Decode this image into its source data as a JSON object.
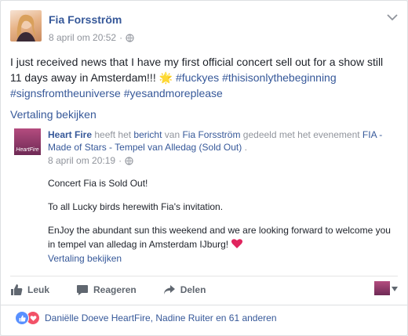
{
  "post": {
    "author": "Fia Forsström",
    "timestamp": "8 april om 20:52",
    "text_plain": "I just received news that I have my first official concert sell out for a show still 11 days away in Amsterdam!!! ",
    "emoji": "🌟",
    "hashtags": [
      "#fuckyes",
      "#thisisonlythebeginning",
      "#signsfromtheuniverse",
      "#yesandmoreplease"
    ],
    "translate_label": "Vertaling bekijken"
  },
  "shared": {
    "avatar_text": "HeartFire",
    "page_name": "Heart Fire",
    "text_1": " heeft het ",
    "link_1": "bericht",
    "text_2": " van ",
    "link_2": "Fia Forsström",
    "text_3": " gedeeld met het evenement ",
    "event_name": "FIA - Made of Stars - Tempel van Alledag (Sold Out)",
    "text_4": " .",
    "timestamp": "8 april om 20:19",
    "paragraph_1": "Concert Fia is Sold Out!",
    "paragraph_2": "To all Lucky birds herewith Fia's invitation.",
    "paragraph_3": "EnJoy the abundant sun this weekend and we are looking forward to welcome you in tempel van alledag in Amsterdam IJburg! ",
    "translate_label": "Vertaling bekijken"
  },
  "actions": {
    "like": "Leuk",
    "comment": "Reageren",
    "share": "Delen"
  },
  "reactions": {
    "summary": "Daniëlle Doeve HeartFire, Nadine Ruiter en 61 anderen"
  },
  "icons": {
    "globe": "globe-icon",
    "chevron": "chevron-down-icon",
    "like": "thumbs-up-icon",
    "comment": "comment-icon",
    "share": "share-arrow-icon",
    "heart": "heart-icon"
  },
  "colors": {
    "link": "#365899",
    "meta": "#90949c",
    "like_reaction": "#5890ff",
    "love_reaction": "#f25268",
    "heart_emoji": "#e0245e"
  }
}
